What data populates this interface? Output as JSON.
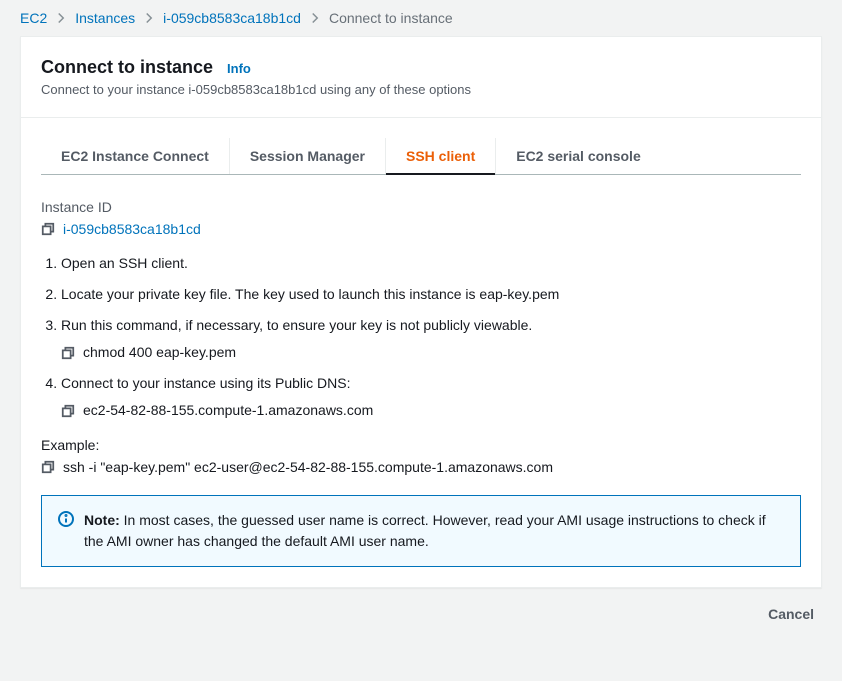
{
  "breadcrumb": {
    "items": [
      "EC2",
      "Instances",
      "i-059cb8583ca18b1cd"
    ],
    "current": "Connect to instance"
  },
  "header": {
    "title": "Connect to instance",
    "info": "Info",
    "subtitle": "Connect to your instance i-059cb8583ca18b1cd using any of these options"
  },
  "tabs": {
    "items": [
      "EC2 Instance Connect",
      "Session Manager",
      "SSH client",
      "EC2 serial console"
    ],
    "activeIndex": 2
  },
  "ssh": {
    "instanceIdLabel": "Instance ID",
    "instanceId": "i-059cb8583ca18b1cd",
    "steps": {
      "0": "Open an SSH client.",
      "1": "Locate your private key file. The key used to launch this instance is eap-key.pem",
      "2": "Run this command, if necessary, to ensure your key is not publicly viewable.",
      "2cmd": "chmod 400 eap-key.pem",
      "3": "Connect to your instance using its Public DNS:",
      "3val": "ec2-54-82-88-155.compute-1.amazonaws.com"
    },
    "exampleLabel": "Example:",
    "exampleCmd": "ssh -i \"eap-key.pem\" ec2-user@ec2-54-82-88-155.compute-1.amazonaws.com",
    "noteLabel": "Note:",
    "noteText": " In most cases, the guessed user name is correct. However, read your AMI usage instructions to check if the AMI owner has changed the default AMI user name."
  },
  "footer": {
    "cancel": "Cancel"
  }
}
